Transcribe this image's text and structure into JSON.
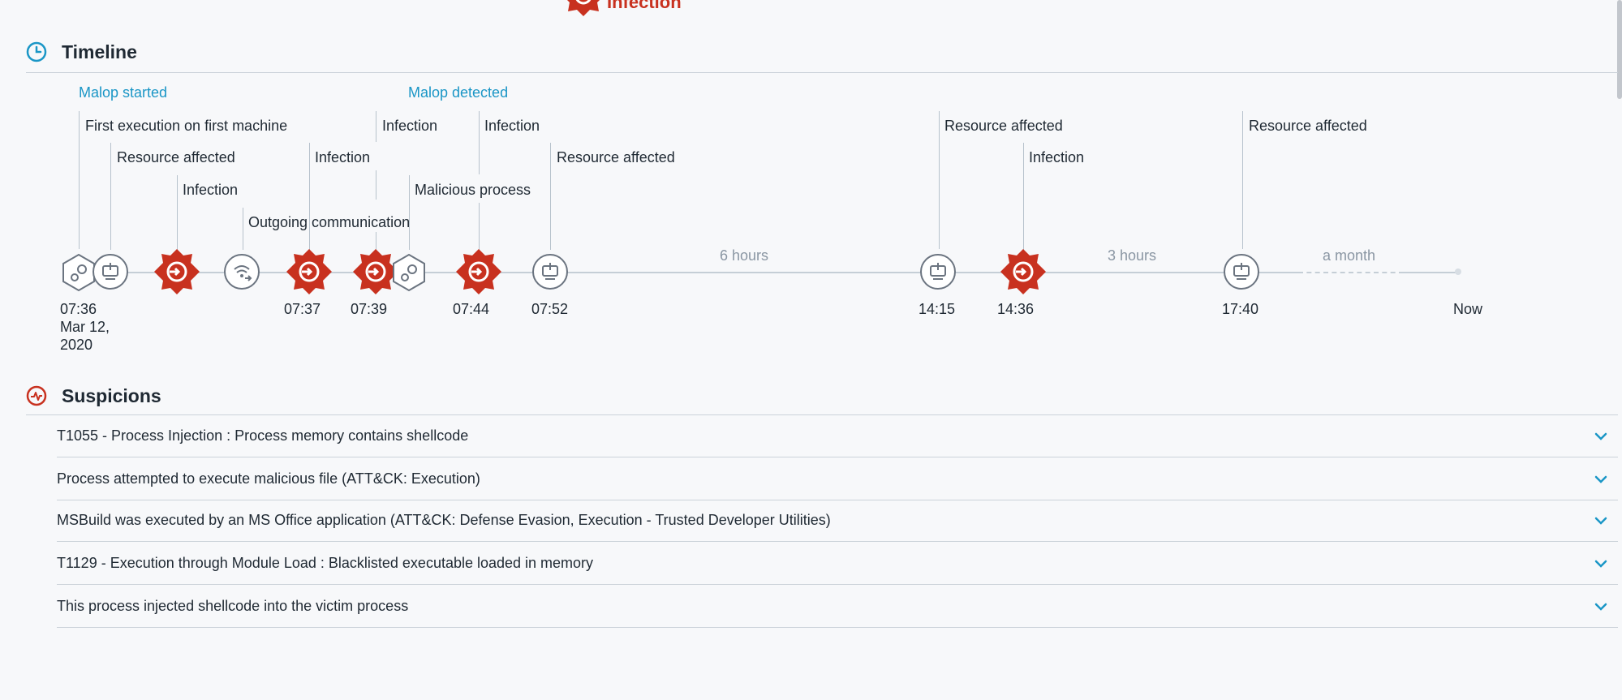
{
  "top": {
    "label": "Infection"
  },
  "timeline": {
    "title": "Timeline",
    "flags": [
      {
        "text": "Malop started",
        "color": "blue"
      },
      {
        "text": "First execution on first machine",
        "color": "normal"
      },
      {
        "text": "Resource affected",
        "color": "normal"
      },
      {
        "text": "Infection",
        "color": "normal"
      },
      {
        "text": "Outgoing communication",
        "color": "normal"
      },
      {
        "text": "Infection",
        "color": "normal"
      },
      {
        "text": "Infection",
        "color": "normal"
      },
      {
        "text": "Malicious process",
        "color": "normal"
      },
      {
        "text": "Malop detected",
        "color": "blue"
      },
      {
        "text": "Infection",
        "color": "normal"
      },
      {
        "text": "Resource affected",
        "color": "normal"
      },
      {
        "text": "Resource affected",
        "color": "normal"
      },
      {
        "text": "Infection",
        "color": "normal"
      },
      {
        "text": "Resource affected",
        "color": "normal"
      }
    ],
    "nodes": [
      {
        "type": "process",
        "icon": "process-gears-icon"
      },
      {
        "type": "resource",
        "icon": "resource-affected-icon"
      },
      {
        "type": "infection",
        "icon": "infection-icon"
      },
      {
        "type": "communication",
        "icon": "outgoing-communication-icon"
      },
      {
        "type": "infection",
        "icon": "infection-icon"
      },
      {
        "type": "infection",
        "icon": "infection-icon"
      },
      {
        "type": "process",
        "icon": "process-gears-icon"
      },
      {
        "type": "infection",
        "icon": "infection-icon"
      },
      {
        "type": "resource",
        "icon": "resource-affected-icon"
      },
      {
        "type": "resource",
        "icon": "resource-affected-icon"
      },
      {
        "type": "infection",
        "icon": "infection-icon"
      },
      {
        "type": "resource",
        "icon": "resource-affected-icon"
      }
    ],
    "times": [
      "07:36",
      "07:37",
      "07:39",
      "07:44",
      "07:52",
      "14:15",
      "14:36",
      "17:40",
      "Now"
    ],
    "start_date": [
      "Mar 12,",
      "2020"
    ],
    "gaps": [
      "6 hours",
      "3 hours",
      "a month"
    ]
  },
  "suspicions": {
    "title": "Suspicions",
    "items": [
      "T1055 - Process Injection : Process memory contains shellcode",
      "Process attempted to execute malicious file (ATT&CK: Execution)",
      "MSBuild was executed by an MS Office application (ATT&CK: Defense Evasion, Execution - Trusted Developer Utilities)",
      "T1129 - Execution through Module Load : Blacklisted executable loaded in memory",
      "This process injected shellcode into the victim process"
    ]
  },
  "colors": {
    "accent": "#1a96c6",
    "danger": "#c8311f",
    "line": "#c5ced6",
    "text": "#1f2933"
  }
}
